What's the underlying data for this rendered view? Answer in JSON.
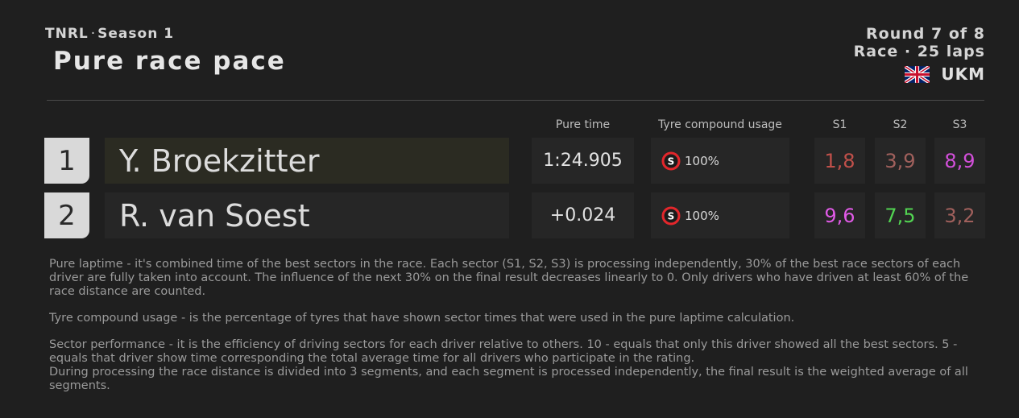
{
  "header": {
    "series": "TNRL",
    "separator": "·",
    "season": "Season 1",
    "title": "Pure race pace",
    "round": "Round 7 of 8",
    "race": "Race · 25 laps",
    "track": "UKM",
    "flag_icon": "uk-flag-icon"
  },
  "columns": {
    "pure_time": "Pure time",
    "tyre_usage": "Tyre compound usage",
    "s1": "S1",
    "s2": "S2",
    "s3": "S3"
  },
  "rows": [
    {
      "position": "1",
      "driver": "Y. Broekzitter",
      "highlight_color": "#2b2b22",
      "time": "1:24.905",
      "tyre_compound": "S",
      "tyre_usage": "100%",
      "s1": "1,8",
      "s1_color": "#c0504a",
      "s2": "3,9",
      "s2_color": "#a0605c",
      "s3": "8,9",
      "s3_color": "#d24fd9"
    },
    {
      "position": "2",
      "driver": "R. van Soest",
      "highlight_color": "#262626",
      "time": "+0.024",
      "tyre_compound": "S",
      "tyre_usage": "100%",
      "s1": "9,6",
      "s1_color": "#e05ae6",
      "s2": "7,5",
      "s2_color": "#52d452",
      "s3": "3,2",
      "s3_color": "#a0605c"
    }
  ],
  "notes": {
    "pure_laptime": "Pure laptime - it's combined time of the best sectors in the race. Each sector (S1, S2, S3) is processing independently, 30% of the best race sectors of each driver are fully taken into account. The influence of the next 30% on the final result decreases linearly to 0. Only drivers who have driven at least 60% of the race distance are counted.",
    "tyre_usage": "Tyre compound usage - is the percentage of tyres that have shown sector times that were used in the pure laptime calculation.",
    "sector_performance": "Sector performance - it is the efficiency of driving sectors for each driver relative to others. 10 - equals that only this driver showed all the best sectors. 5 - equals that driver show time corresponding the total average time for all drivers who participate in the rating.",
    "processing": "During processing the race distance is divided into 3 segments, and each segment is processed independently, the final result is the weighted average of all segments."
  },
  "colors": {
    "background": "#1f1f1f",
    "cell": "#262626",
    "soft_tyre": "#e3262b"
  }
}
